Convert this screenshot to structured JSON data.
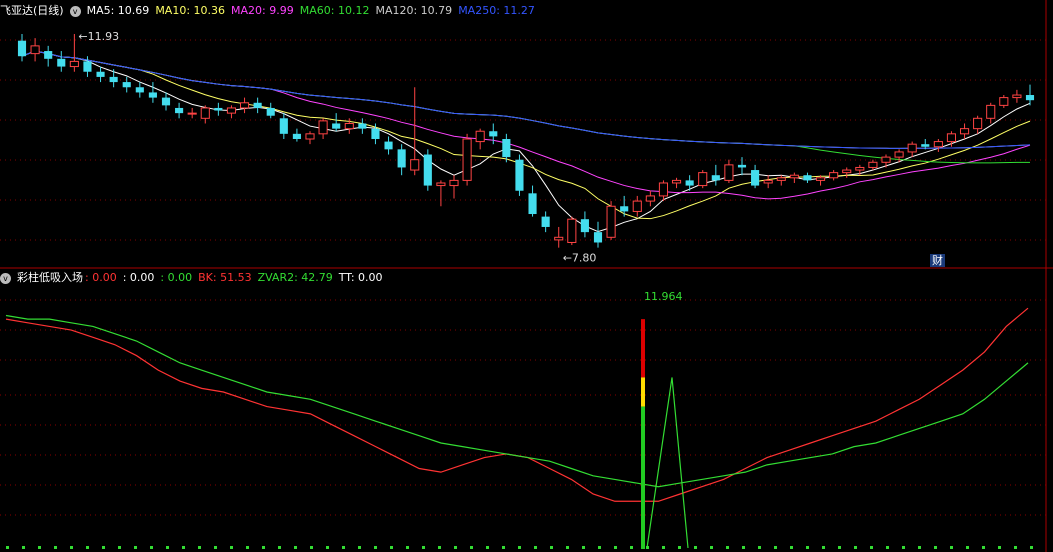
{
  "header": {
    "title": "飞亚达(日线)",
    "ma": [
      {
        "label": "MA5: 10.69",
        "color": "#ffffff"
      },
      {
        "label": "MA10: 10.36",
        "color": "#ffff66"
      },
      {
        "label": "MA20: 9.99",
        "color": "#ff44ff"
      },
      {
        "label": "MA60: 10.12",
        "color": "#33dd33"
      },
      {
        "label": "MA120: 10.79",
        "color": "#cccccc"
      },
      {
        "label": "MA250: 11.27",
        "color": "#3355ff"
      }
    ]
  },
  "indicator": {
    "title": "彩柱低吸入场",
    "values": [
      {
        "label": ": 0.00",
        "color": "#ff3333"
      },
      {
        "label": ": 0.00",
        "color": "#ffffff"
      },
      {
        "label": ": 0.00",
        "color": "#33dd33"
      },
      {
        "label": "BK: 51.53",
        "color": "#ff3333"
      },
      {
        "label": "ZVAR2: 42.79",
        "color": "#33dd33"
      },
      {
        "label": "TT: 0.00",
        "color": "#ffffff"
      }
    ]
  },
  "badge": "财",
  "colors": {
    "up": "#ff4444",
    "down": "#44ddee",
    "grid": "#880000",
    "axis": "#aa0000"
  },
  "chart_data": [
    {
      "type": "candlestick",
      "annotations": [
        {
          "text": "11.93",
          "index": 4
        },
        {
          "text": "7.80",
          "index": 41
        }
      ],
      "ohlc": [
        [
          11.8,
          11.93,
          11.4,
          11.5
        ],
        [
          11.55,
          11.85,
          11.4,
          11.7
        ],
        [
          11.6,
          11.7,
          11.3,
          11.45
        ],
        [
          11.45,
          11.6,
          11.2,
          11.3
        ],
        [
          11.3,
          11.93,
          11.2,
          11.4
        ],
        [
          11.4,
          11.5,
          11.1,
          11.2
        ],
        [
          11.2,
          11.3,
          11.0,
          11.1
        ],
        [
          11.1,
          11.25,
          10.9,
          11.0
        ],
        [
          11.0,
          11.1,
          10.8,
          10.9
        ],
        [
          10.9,
          11.0,
          10.7,
          10.8
        ],
        [
          10.8,
          11.0,
          10.6,
          10.7
        ],
        [
          10.7,
          10.8,
          10.45,
          10.55
        ],
        [
          10.5,
          10.6,
          10.3,
          10.4
        ],
        [
          10.4,
          10.5,
          10.3,
          10.4
        ],
        [
          10.3,
          10.55,
          10.2,
          10.5
        ],
        [
          10.5,
          10.6,
          10.35,
          10.45
        ],
        [
          10.4,
          10.55,
          10.3,
          10.5
        ],
        [
          10.5,
          10.7,
          10.4,
          10.6
        ],
        [
          10.6,
          10.7,
          10.4,
          10.5
        ],
        [
          10.5,
          10.6,
          10.3,
          10.35
        ],
        [
          10.3,
          10.4,
          9.9,
          10.0
        ],
        [
          10.0,
          10.1,
          9.85,
          9.9
        ],
        [
          9.9,
          10.05,
          9.8,
          10.0
        ],
        [
          10.0,
          10.3,
          9.9,
          10.25
        ],
        [
          10.2,
          10.4,
          10.05,
          10.1
        ],
        [
          10.1,
          10.3,
          10.0,
          10.2
        ],
        [
          10.2,
          10.3,
          10.0,
          10.1
        ],
        [
          10.1,
          10.2,
          9.8,
          9.9
        ],
        [
          9.85,
          9.95,
          9.6,
          9.7
        ],
        [
          9.7,
          9.8,
          9.2,
          9.35
        ],
        [
          9.3,
          10.9,
          9.2,
          9.5
        ],
        [
          9.6,
          9.7,
          8.9,
          9.0
        ],
        [
          9.0,
          9.1,
          8.6,
          9.05
        ],
        [
          9.0,
          9.2,
          8.75,
          9.1
        ],
        [
          9.1,
          10.0,
          9.0,
          9.9
        ],
        [
          9.85,
          10.1,
          9.7,
          10.05
        ],
        [
          10.05,
          10.2,
          9.8,
          9.95
        ],
        [
          9.9,
          10.0,
          9.45,
          9.55
        ],
        [
          9.5,
          9.6,
          8.8,
          8.9
        ],
        [
          8.85,
          9.0,
          8.4,
          8.45
        ],
        [
          8.4,
          8.5,
          8.1,
          8.2
        ],
        [
          7.95,
          8.2,
          7.8,
          8.0
        ],
        [
          7.9,
          8.4,
          7.85,
          8.35
        ],
        [
          8.35,
          8.5,
          8.0,
          8.1
        ],
        [
          8.1,
          8.3,
          7.8,
          7.9
        ],
        [
          8.0,
          8.7,
          7.95,
          8.6
        ],
        [
          8.6,
          8.8,
          8.4,
          8.5
        ],
        [
          8.5,
          8.8,
          8.4,
          8.7
        ],
        [
          8.7,
          8.9,
          8.6,
          8.8
        ],
        [
          8.8,
          9.1,
          8.7,
          9.05
        ],
        [
          9.05,
          9.15,
          8.95,
          9.1
        ],
        [
          9.1,
          9.2,
          8.9,
          9.0
        ],
        [
          9.0,
          9.3,
          8.95,
          9.25
        ],
        [
          9.2,
          9.4,
          9.0,
          9.1
        ],
        [
          9.1,
          9.5,
          9.05,
          9.4
        ],
        [
          9.4,
          9.55,
          9.2,
          9.35
        ],
        [
          9.3,
          9.4,
          8.95,
          9.0
        ],
        [
          9.05,
          9.2,
          8.95,
          9.1
        ],
        [
          9.1,
          9.2,
          9.0,
          9.15
        ],
        [
          9.15,
          9.25,
          9.05,
          9.2
        ],
        [
          9.2,
          9.25,
          9.05,
          9.1
        ],
        [
          9.1,
          9.2,
          9.0,
          9.15
        ],
        [
          9.15,
          9.3,
          9.1,
          9.25
        ],
        [
          9.25,
          9.35,
          9.15,
          9.3
        ],
        [
          9.3,
          9.4,
          9.2,
          9.35
        ],
        [
          9.35,
          9.5,
          9.3,
          9.45
        ],
        [
          9.45,
          9.6,
          9.35,
          9.55
        ],
        [
          9.55,
          9.7,
          9.45,
          9.65
        ],
        [
          9.65,
          9.85,
          9.55,
          9.8
        ],
        [
          9.8,
          9.9,
          9.7,
          9.75
        ],
        [
          9.75,
          9.9,
          9.65,
          9.85
        ],
        [
          9.85,
          10.05,
          9.75,
          10.0
        ],
        [
          10.0,
          10.2,
          9.9,
          10.1
        ],
        [
          10.1,
          10.35,
          10.0,
          10.3
        ],
        [
          10.3,
          10.6,
          10.2,
          10.55
        ],
        [
          10.55,
          10.75,
          10.5,
          10.7
        ],
        [
          10.7,
          10.85,
          10.6,
          10.75
        ],
        [
          10.75,
          10.95,
          10.55,
          10.65
        ]
      ]
    },
    {
      "type": "line",
      "series": [
        {
          "name": "BK",
          "values": [
            62,
            61,
            60,
            59,
            57,
            55,
            52,
            48,
            45,
            43,
            42,
            40,
            38,
            37,
            36,
            33,
            30,
            27,
            24,
            21,
            20,
            22,
            24,
            25,
            24,
            21,
            18,
            14,
            12,
            12,
            12,
            14,
            16,
            18,
            21,
            24,
            26,
            28,
            30,
            32,
            34,
            37,
            40,
            44,
            48,
            53,
            60,
            65
          ],
          "color": "#ff3333"
        },
        {
          "name": "ZVAR2",
          "values": [
            63,
            62,
            62,
            61,
            60,
            58,
            56,
            53,
            50,
            48,
            46,
            44,
            42,
            41,
            40,
            38,
            36,
            34,
            32,
            30,
            28,
            27,
            26,
            25,
            24,
            23,
            21,
            19,
            18,
            17,
            16,
            17,
            18,
            19,
            20,
            22,
            23,
            24,
            25,
            27,
            28,
            30,
            32,
            34,
            36,
            40,
            45,
            50
          ],
          "color": "#33dd33"
        }
      ]
    }
  ]
}
